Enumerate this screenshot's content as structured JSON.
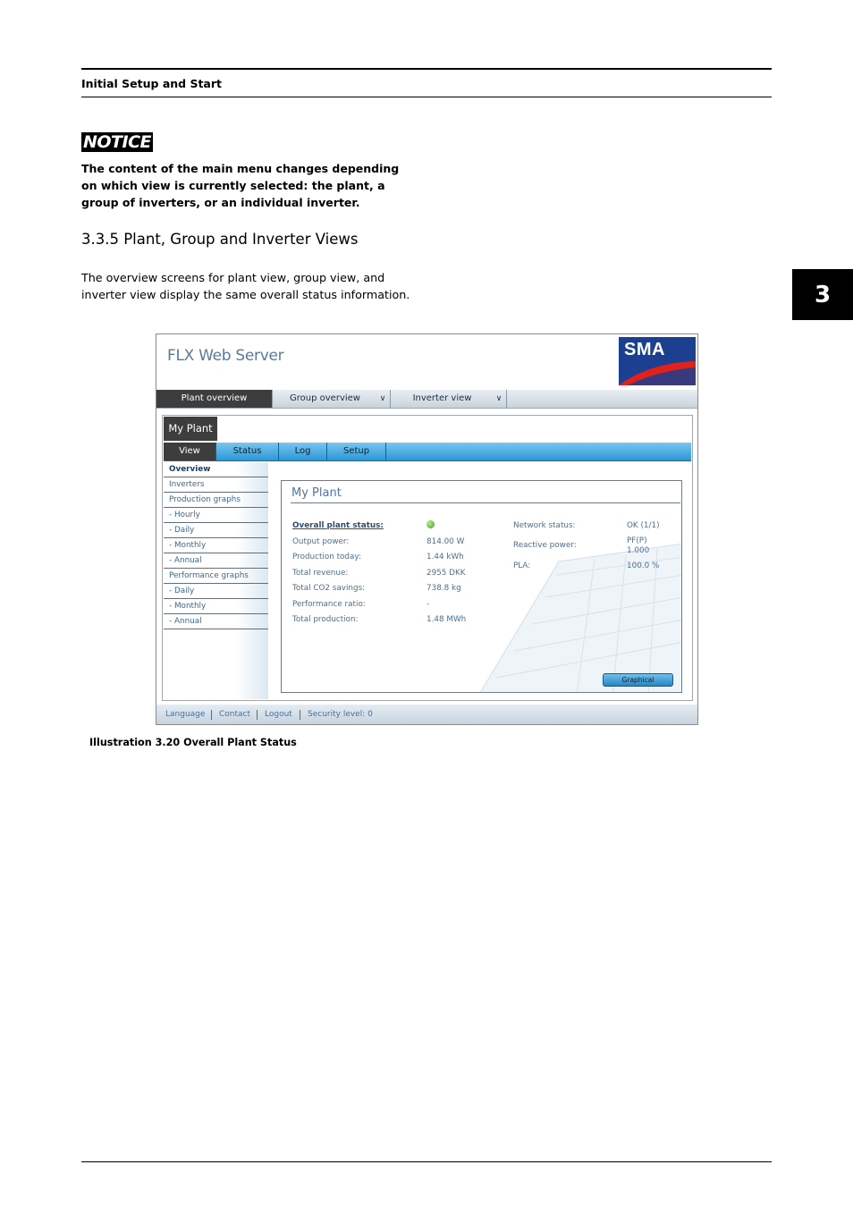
{
  "page": {
    "running_header": "Initial Setup and Start",
    "chapter_tab": "3",
    "notice_title": "NOTICE",
    "notice_body": "The content of the main menu changes depending on which view is currently selected: the plant, a group of inverters, or an individual inverter.",
    "section_heading": "3.3.5  Plant, Group and Inverter Views",
    "section_body": "The overview screens for plant view, group view, and inverter view display the same overall status information.",
    "caption": "Illustration 3.20 Overall Plant Status"
  },
  "screenshot": {
    "app_title": "FLX Web Server",
    "logo_text": "SMA",
    "colors": {
      "accent_blue": "#2a98d6",
      "logo_blue": "#1c3f8f",
      "logo_red": "#e2231a",
      "status_green": "#3e9d1c"
    },
    "top_nav": [
      {
        "label": "Plant overview",
        "active": true
      },
      {
        "label": "Group overview",
        "dropdown": true
      },
      {
        "label": "Inverter view",
        "dropdown": true
      }
    ],
    "context_tab": "My Plant",
    "sub_nav": [
      "View",
      "Status",
      "Log",
      "Setup"
    ],
    "sidebar": [
      "Overview",
      "Inverters",
      "Production graphs",
      "- Hourly",
      "- Daily",
      "- Monthly",
      "- Annual",
      "Performance graphs",
      "- Daily",
      "- Monthly",
      "- Annual"
    ],
    "panel": {
      "title": "My Plant",
      "status_label": "Overall plant status:",
      "left_labels": [
        "Output power:",
        "Production today:",
        "Total revenue:",
        "Total CO2 savings:",
        "Performance ratio:",
        "Total production:"
      ],
      "left_values": [
        "814.00 W",
        "1.44 kWh",
        "2955 DKK",
        "738.8 kg",
        "-",
        "1.48 MWh"
      ],
      "right_labels": [
        "Network status:",
        "Reactive power:",
        "PLA:"
      ],
      "right_values": [
        "OK (1/1)",
        "PF(P)",
        "100.0 %"
      ],
      "reactive_sub": "1.000",
      "button": "Graphical"
    },
    "footer": [
      "Language",
      "Contact",
      "Logout",
      "Security level: 0"
    ]
  }
}
